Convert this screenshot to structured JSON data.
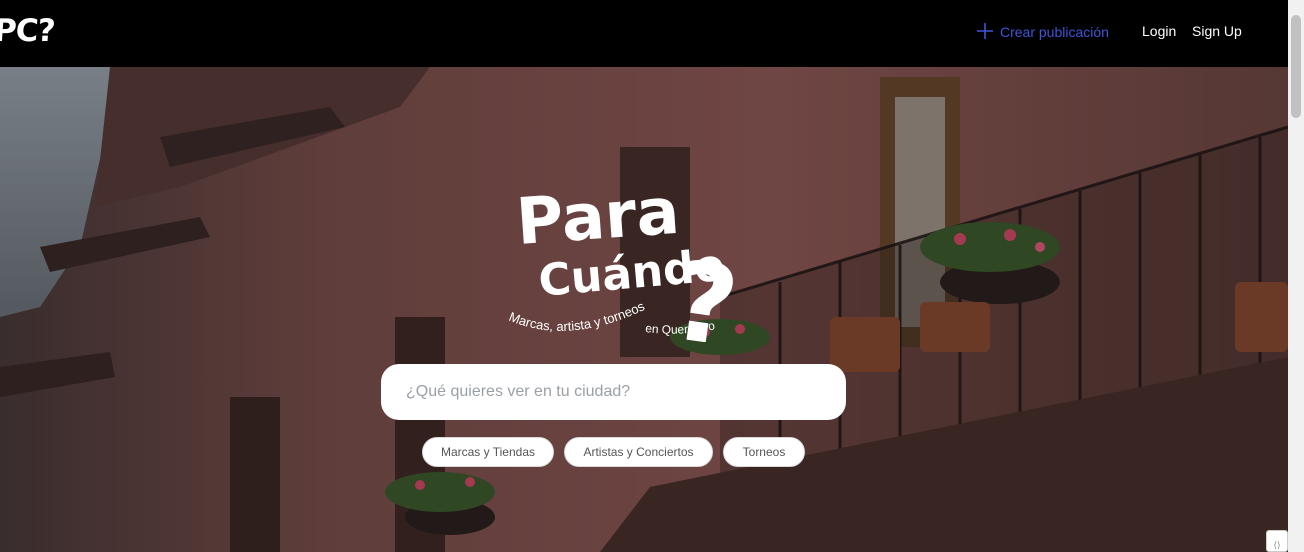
{
  "header": {
    "logo_text": "PC?",
    "create_label": "Crear publicación",
    "login_label": "Login",
    "signup_label": "Sign Up",
    "accent_color": "#3f56d6"
  },
  "hero": {
    "brand_line_1": "Para",
    "brand_line_2": "Cuándo",
    "tagline_1": "Marcas, artista y torneos",
    "tagline_2": "en Querétaro",
    "search": {
      "placeholder": "¿Qué quieres ver en tu ciudad?",
      "value": ""
    },
    "chips": [
      "Marcas y Tiendas",
      "Artistas y Conciertos",
      "Torneos"
    ]
  },
  "icons": {
    "create": "plus-icon",
    "corner": "resize-icon"
  }
}
